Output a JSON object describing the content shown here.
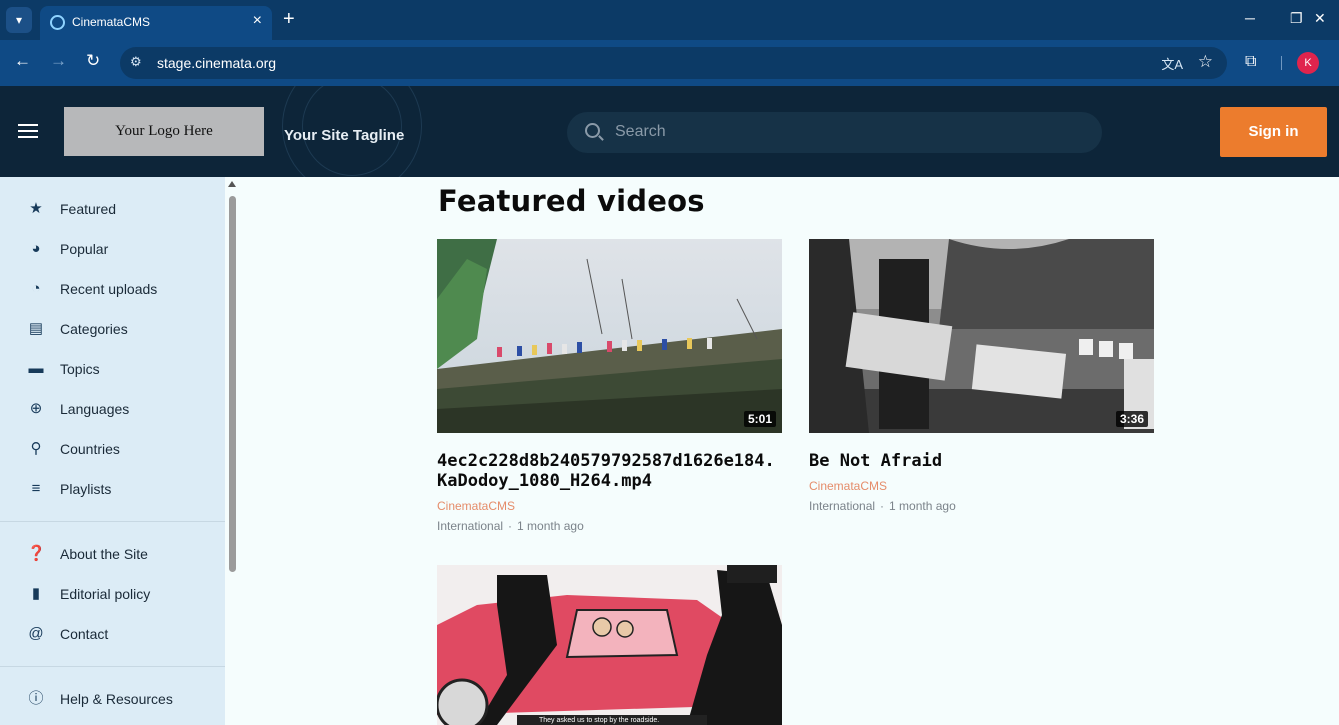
{
  "browser": {
    "tab_title": "CinemataCMS",
    "url": "stage.cinemata.org",
    "profile_initial": "K"
  },
  "header": {
    "logo_text": "Your Logo Here",
    "tagline": "Your Site Tagline",
    "search_placeholder": "Search",
    "signin_label": "Sign in"
  },
  "sidebar": {
    "items": [
      {
        "label": "Featured",
        "icon": "star-icon"
      },
      {
        "label": "Popular",
        "icon": "trending-icon"
      },
      {
        "label": "Recent uploads",
        "icon": "recent-icon"
      },
      {
        "label": "Categories",
        "icon": "categories-icon"
      },
      {
        "label": "Topics",
        "icon": "topics-icon"
      },
      {
        "label": "Languages",
        "icon": "globe-icon"
      },
      {
        "label": "Countries",
        "icon": "pin-icon"
      },
      {
        "label": "Playlists",
        "icon": "playlist-icon"
      }
    ],
    "secondary": [
      {
        "label": "About the Site",
        "icon": "help-icon"
      },
      {
        "label": "Editorial policy",
        "icon": "document-icon"
      },
      {
        "label": "Contact",
        "icon": "at-icon"
      }
    ],
    "tertiary": [
      {
        "label": "Help & Resources",
        "icon": "info-icon"
      }
    ]
  },
  "main": {
    "section_title": "Featured videos",
    "videos": [
      {
        "title": "4ec2c228d8b240579792587d1626e184.KaDodoy_1080_H264.mp4",
        "duration": "5:01",
        "author": "CinemataCMS",
        "category": "International",
        "age": "1 month ago"
      },
      {
        "title": "Be Not Afraid",
        "duration": "3:36",
        "author": "CinemataCMS",
        "category": "International",
        "age": "1 month ago"
      },
      {
        "caption": "They asked us to stop by the roadside."
      }
    ]
  }
}
